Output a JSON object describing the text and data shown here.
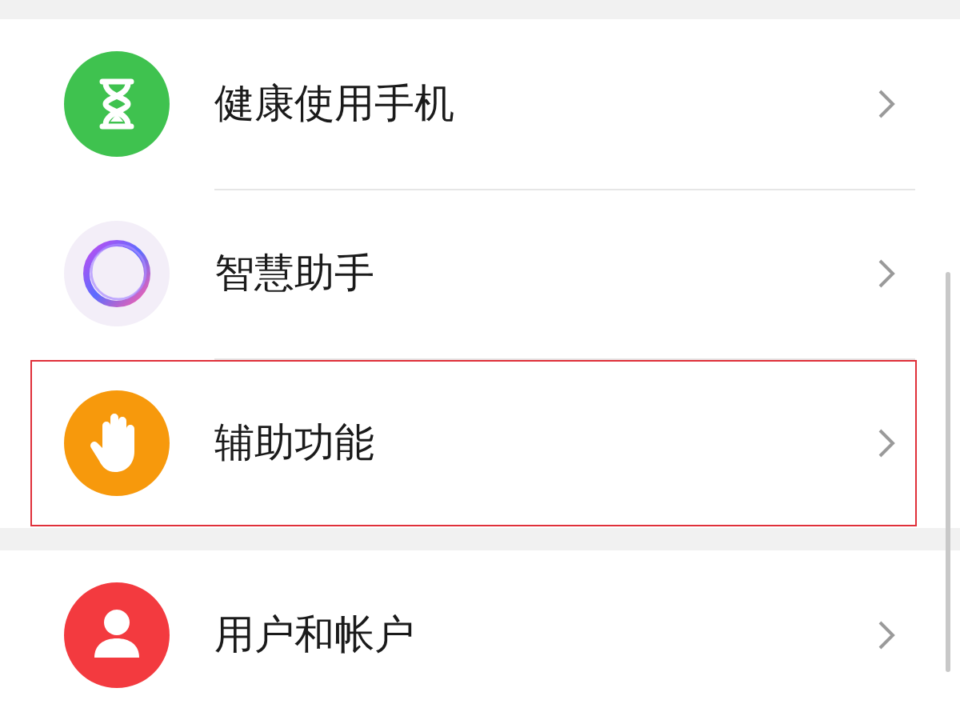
{
  "groups": [
    {
      "items": [
        {
          "label": "健康使用手机",
          "kind": "hourglass",
          "highlighted": false
        },
        {
          "label": "智慧助手",
          "kind": "ring",
          "highlighted": false
        },
        {
          "label": "辅助功能",
          "kind": "hand",
          "highlighted": true
        }
      ]
    },
    {
      "items": [
        {
          "label": "用户和帐户",
          "kind": "user",
          "highlighted": false
        }
      ]
    }
  ]
}
